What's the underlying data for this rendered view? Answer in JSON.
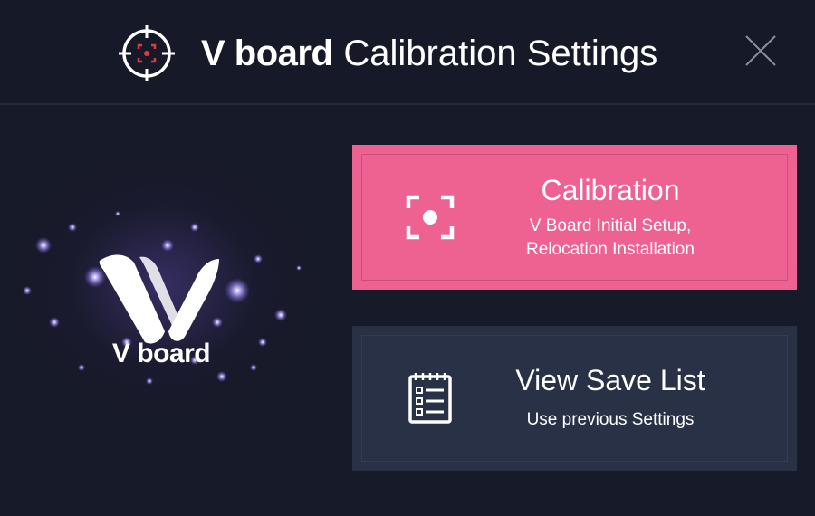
{
  "header": {
    "brand": "V board",
    "title_rest": "Calibration Settings",
    "icon": "crosshair-target-icon",
    "close_icon": "close-icon"
  },
  "logo": {
    "text": "V board",
    "icon": "v-board-logo-icon"
  },
  "cards": {
    "calibration": {
      "title": "Calibration",
      "subtitle_line1": "V Board Initial Setup,",
      "subtitle_line2": "Relocation Installation",
      "icon": "camera-focus-icon",
      "color": "#ee6292"
    },
    "save_list": {
      "title": "View Save List",
      "subtitle_line1": "Use previous Settings",
      "icon": "checklist-icon",
      "color": "#293146"
    }
  },
  "colors": {
    "background": "#171a28",
    "accent": "#ee6292",
    "target_red": "#e03a3e"
  }
}
